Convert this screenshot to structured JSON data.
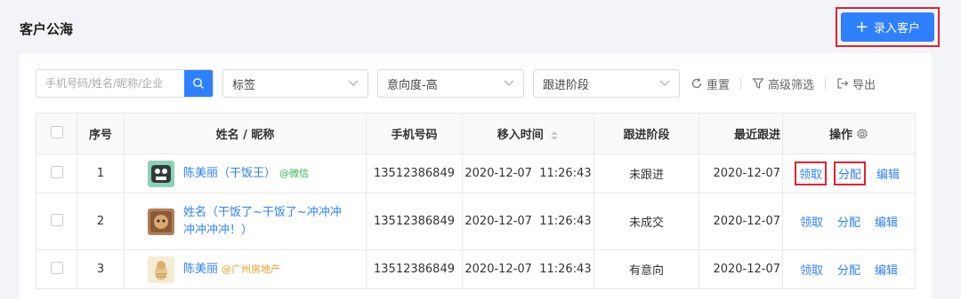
{
  "header": {
    "title": "客户公海",
    "add_button": "录入客户"
  },
  "filters": {
    "search_placeholder": "手机号码/姓名/昵称/企业",
    "tag_select": "标签",
    "intent_select": "意向度-高",
    "stage_select": "跟进阶段",
    "reset_label": "重置",
    "advanced_filter_label": "高级筛选",
    "export_label": "导出"
  },
  "table": {
    "headers": {
      "index": "序号",
      "name": "姓名 / 昵称",
      "phone": "手机号码",
      "move_time": "移入时间",
      "stage": "跟进阶段",
      "last_follow": "最近跟进",
      "actions": "操作"
    },
    "rows": [
      {
        "index": "1",
        "name": "陈美丽（干饭王）",
        "tag": "@微信",
        "tag_type": "wechat",
        "phone": "13512386849",
        "move_time": "2020-12-07  11:26:43",
        "stage": "未跟进",
        "last_follow": "2020-12-07"
      },
      {
        "index": "2",
        "name": "姓名（干饭了~干饭了~冲冲冲冲冲冲冲！）",
        "tag": "",
        "tag_type": "",
        "phone": "13512386849",
        "move_time": "2020-12-07  11:26:43",
        "stage": "未成交",
        "last_follow": "2020-12-07"
      },
      {
        "index": "3",
        "name": "陈美丽",
        "tag": "@广州房地产",
        "tag_type": "company",
        "phone": "13512386849",
        "move_time": "2020-12-07  11:26:43",
        "stage": "有意向",
        "last_follow": "2020-12-07"
      }
    ],
    "actions": {
      "claim": "领取",
      "assign": "分配",
      "edit": "编辑"
    }
  },
  "colors": {
    "primary": "#2f80ff",
    "highlight_box": "#e5222c",
    "wechat_tag": "#30b855",
    "company_tag": "#f59a23"
  }
}
